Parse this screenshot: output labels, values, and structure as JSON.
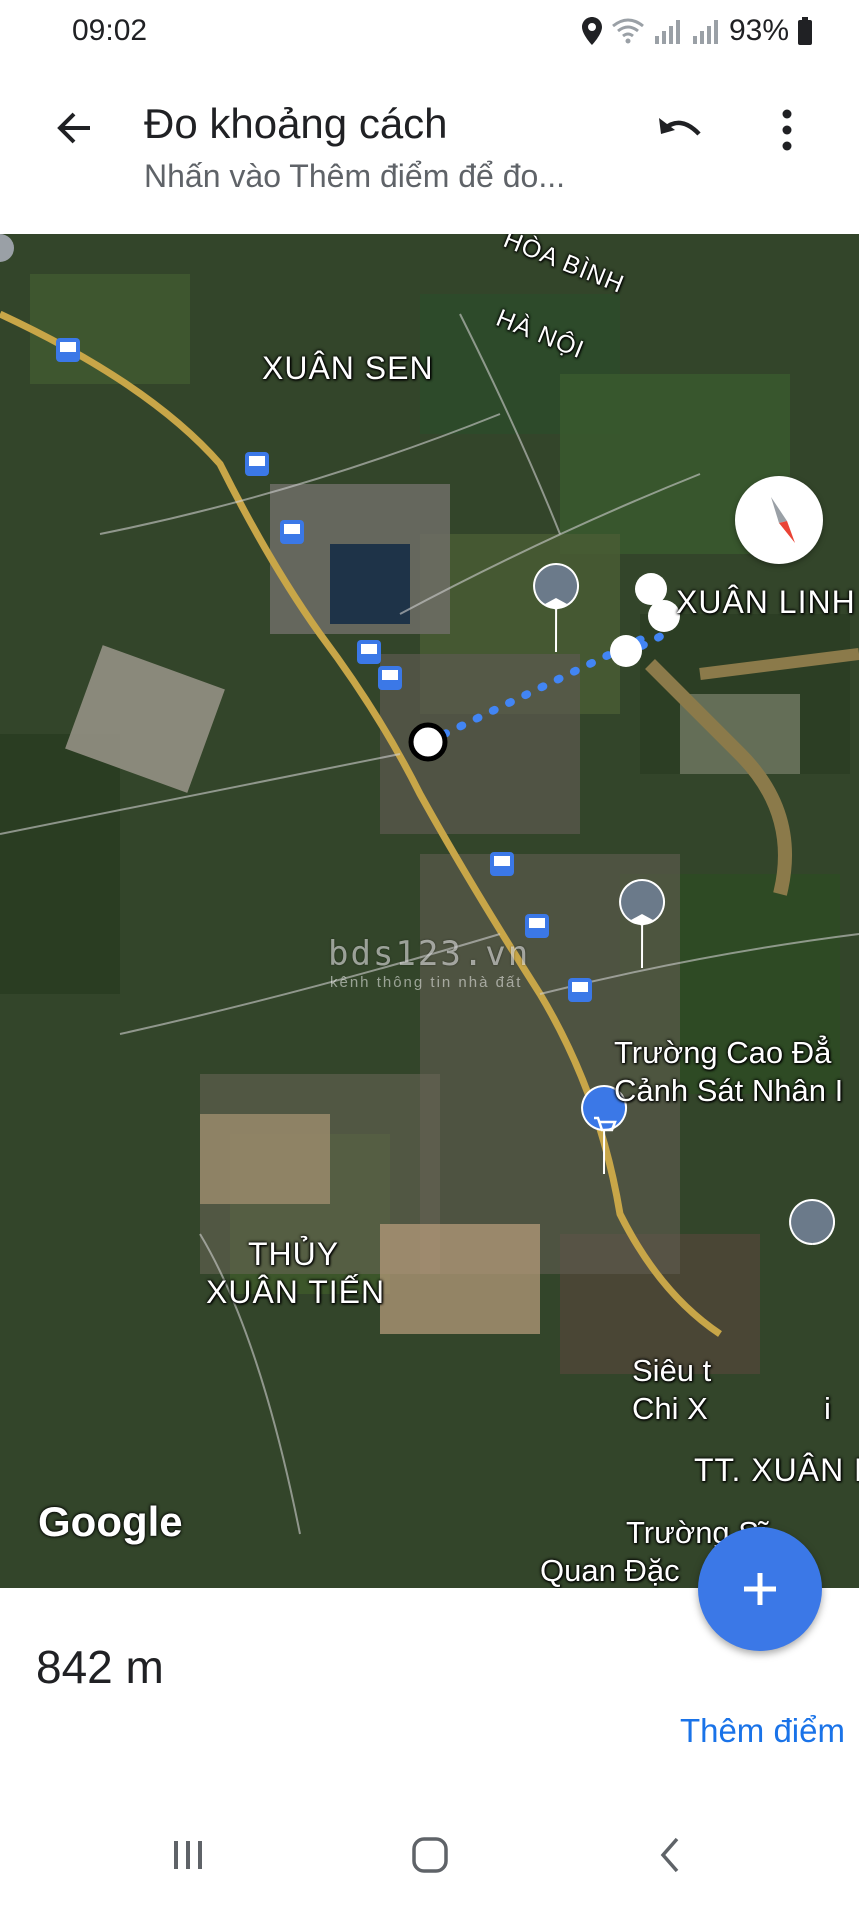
{
  "status_bar": {
    "time": "09:02",
    "battery": "93%",
    "icons": [
      "location-icon",
      "wifi-icon",
      "signal-icon",
      "signal-icon",
      "battery-icon"
    ]
  },
  "app_bar": {
    "title": "Đo khoảng cách",
    "subtitle": "Nhấn vào Thêm điểm để đo...",
    "icons": [
      "back-arrow-icon",
      "undo-icon",
      "more-vert-icon"
    ]
  },
  "map": {
    "labels": {
      "hoa_binh": "HÒA BÌNH",
      "ha_noi": "HÀ NỘI",
      "xuan_sen": "XUÂN SEN",
      "xuan_linh": "XUÂN LINH",
      "thuy": "THỦY",
      "xuan_tien": "XUÂN TIẾN",
      "tt_xuan_m": "TT. XUÂN M",
      "truong_cao_dang_1": "Trường Cao Đẳ",
      "truong_cao_dang_2": "Cảnh Sát Nhân I",
      "sieu_thi_1": "Siêu t",
      "sieu_thi_2": "Chi X",
      "sieu_thi_3": "i",
      "truong_si_1": "Trường Sĩ",
      "truong_si_2": "Quan Đặc"
    },
    "watermark": "bds123.vn",
    "watermark_sub": "kênh thông tin nhà đất",
    "attribution": "Google",
    "icons": [
      "compass-icon",
      "my-location-icon",
      "bus-stop-icon",
      "school-pin-icon",
      "shopping-pin-icon"
    ],
    "colors": {
      "route": "#4285f4",
      "fab": "#3b78e7"
    }
  },
  "measurement": {
    "distance": "842 m",
    "add_point": "Thêm điểm",
    "fab_icon": "plus-icon"
  },
  "nav_bar": {
    "icons": [
      "recent-apps-icon",
      "home-icon",
      "back-icon"
    ]
  }
}
